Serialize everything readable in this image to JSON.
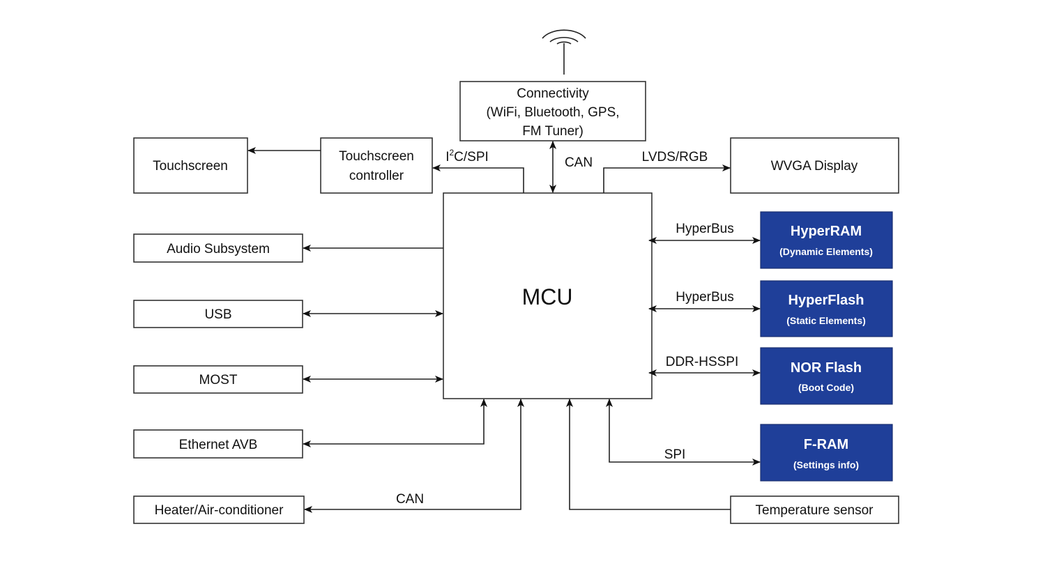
{
  "colors": {
    "memory_block": "#1f3f99",
    "line": "#222222"
  },
  "blocks": {
    "mcu": "MCU",
    "connectivity": [
      "Connectivity",
      "(WiFi, Bluetooth, GPS,",
      "FM Tuner)"
    ],
    "touchscreen": "Touchscreen",
    "touchscreen_controller": [
      "Touchscreen",
      "controller"
    ],
    "wvga_display": "WVGA Display",
    "audio": "Audio Subsystem",
    "usb": "USB",
    "most": "MOST",
    "ethernet": "Ethernet AVB",
    "heater": "Heater/Air-conditioner",
    "temperature": "Temperature sensor",
    "hyperram": {
      "title": "HyperRAM",
      "sub": "(Dynamic Elements)"
    },
    "hyperflash": {
      "title": "HyperFlash",
      "sub": "(Static Elements)"
    },
    "norflash": {
      "title": "NOR Flash",
      "sub": "(Boot Code)"
    },
    "fram": {
      "title": "F-RAM",
      "sub": "(Settings info)"
    }
  },
  "links": {
    "i2c_spi": {
      "base": "I",
      "sup": "2",
      "rest": "C/SPI"
    },
    "can_top": "CAN",
    "lvds": "LVDS/RGB",
    "hyperbus1": "HyperBus",
    "hyperbus2": "HyperBus",
    "ddr_hsspi": "DDR-HSSPI",
    "spi": "SPI",
    "can_bottom": "CAN"
  },
  "icons": {
    "antenna": "antenna-icon"
  }
}
